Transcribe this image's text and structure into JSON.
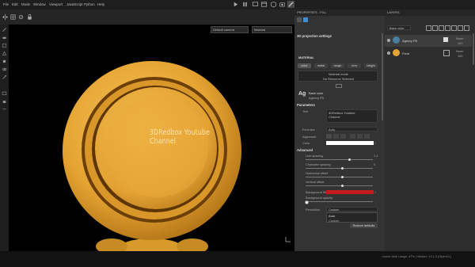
{
  "menu": [
    "File",
    "Edit",
    "Mode",
    "Window",
    "Viewport",
    "JavaScript",
    "Python",
    "Help"
  ],
  "viewport": {
    "camera_select": "Default camera",
    "material_select": "Material",
    "overlay_line1": "3DRedbox Youtube",
    "overlay_line2": "Channel"
  },
  "properties": {
    "panel_title": "PROPERTIES - FILL",
    "section_projection": "3D projection settings",
    "section_material": "MATERIAL",
    "material_channels": [
      "color",
      "metal",
      "rough",
      "nrm",
      "height"
    ],
    "material_mode_label": "Material mode",
    "material_mode_value": "No Resource Selected",
    "text_resource_name": "Base color",
    "text_resource_font": "Agency FB",
    "section_parameters": "Parameters",
    "text_label": "Text",
    "text_value_line1": "3DRedbox Youtube",
    "text_value_line2": "Channel",
    "font_size_label": "Font size",
    "font_size_value": "Auto",
    "alignment_label": "Alignment",
    "color_label": "Color",
    "section_advanced": "Advanced",
    "line_spacing_label": "Line spacing",
    "line_spacing_value": "1.1",
    "line_spacing_fraction": 0.65,
    "char_spacing_label": "Character spacing",
    "char_spacing_value": "0",
    "char_spacing_fraction": 0.55,
    "h_offset_label": "Horizontal offset",
    "h_offset_fraction": 0.55,
    "v_offset_label": "Vertical offset",
    "v_offset_fraction": 0.55,
    "background_fill_label": "Background fill",
    "background_opacity_label": "Background opacity",
    "background_opacity_fraction": 0.0,
    "resolution_label": "Resolution",
    "resolution_value": "Custom",
    "dropdown_options": [
      "Auto",
      "Custom"
    ],
    "restore_defaults": "Restore defaults",
    "colors": {
      "text_color": "#ffffff",
      "background_fill": "#c41a1a"
    }
  },
  "layers": {
    "panel_title": "LAYERS",
    "channel_select": "Base color",
    "items": [
      {
        "name": "Agency FB",
        "blend": "Norm",
        "opacity": "100"
      },
      {
        "name": "Fond",
        "blend": "Norm",
        "opacity": "100"
      }
    ]
  },
  "status": {
    "text": "Cache Disk Usage: 47% | Version: 10.1.0 (OpenGL)"
  },
  "icons": {
    "left_tools": [
      "paint-brush-icon",
      "eraser-icon",
      "projection-icon",
      "polygon-fill-icon",
      "smudge-icon",
      "clone-icon",
      "color-picker-icon",
      "camera-icon",
      "lock-icon",
      "measure-icon"
    ],
    "top_tools": [
      "play-icon",
      "pause-icon",
      "screen-icon",
      "window-icon",
      "cube-icon",
      "camera-icon",
      "display-icon",
      "select-icon",
      "brush-icon",
      "crop-icon",
      "eye-icon"
    ]
  },
  "theme": {
    "accent": "#3a8fd6",
    "sphere_main": "#e5a431",
    "sphere_dark": "#7a4b08",
    "overlay_text": "#fde4b0"
  }
}
